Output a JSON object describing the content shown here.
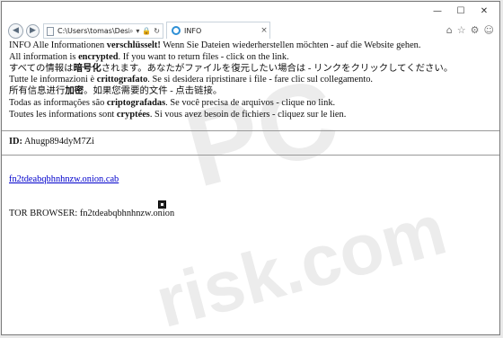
{
  "window": {
    "controls": {
      "minimize": "—",
      "maximize": "☐",
      "close": "✕"
    }
  },
  "browser": {
    "back_icon": "◀",
    "forward_icon": "▶",
    "address": "C:\\Users\\tomas\\Desktop\\REA",
    "address_tools": [
      "⌕",
      "▾",
      "🔒",
      "↻"
    ],
    "tab": {
      "title": "INFO",
      "close": "×"
    },
    "toolbar_icons": [
      "⌂",
      "☆",
      "⚙",
      "☺"
    ]
  },
  "content": {
    "lines": [
      {
        "pre": "INFO Alle Informationen ",
        "bold": "verschlüsselt!",
        "post": " Wenn Sie Dateien wiederherstellen möchten - auf die Website gehen."
      },
      {
        "pre": "All information is ",
        "bold": "encrypted",
        "post": ". If you want to return files - click on the link."
      },
      {
        "pre": "すべての情報は",
        "bold": "暗号化",
        "post": "されます。あなたがファイルを復元したい場合は - リンクをクリックしてください。"
      },
      {
        "pre": "Tutte le informazioni è ",
        "bold": "crittografato",
        "post": ". Se si desidera ripristinare i file - fare clic sul collegamento."
      },
      {
        "pre": "所有信息进行",
        "bold": "加密",
        "post": "。如果您需要的文件 - 点击链接。"
      },
      {
        "pre": "Todas as informações são ",
        "bold": "criptografadas",
        "post": ". Se você precisa de arquivos - clique no link."
      },
      {
        "pre": "Toutes les informations sont ",
        "bold": "cryptées",
        "post": ". Si vous avez besoin de fichiers - cliquez sur le lien."
      }
    ],
    "id_label": "ID:",
    "id_value": "Ahugp894dyM7Zi",
    "onion_link": "fn2tdeabqbhnhnzw.onion.cab",
    "tor_line": "TOR BROWSER: fn2tdeabqbhnhnzw.onion"
  },
  "watermark": {
    "text": "PC risk.com",
    "color": "#d9d9d9"
  }
}
